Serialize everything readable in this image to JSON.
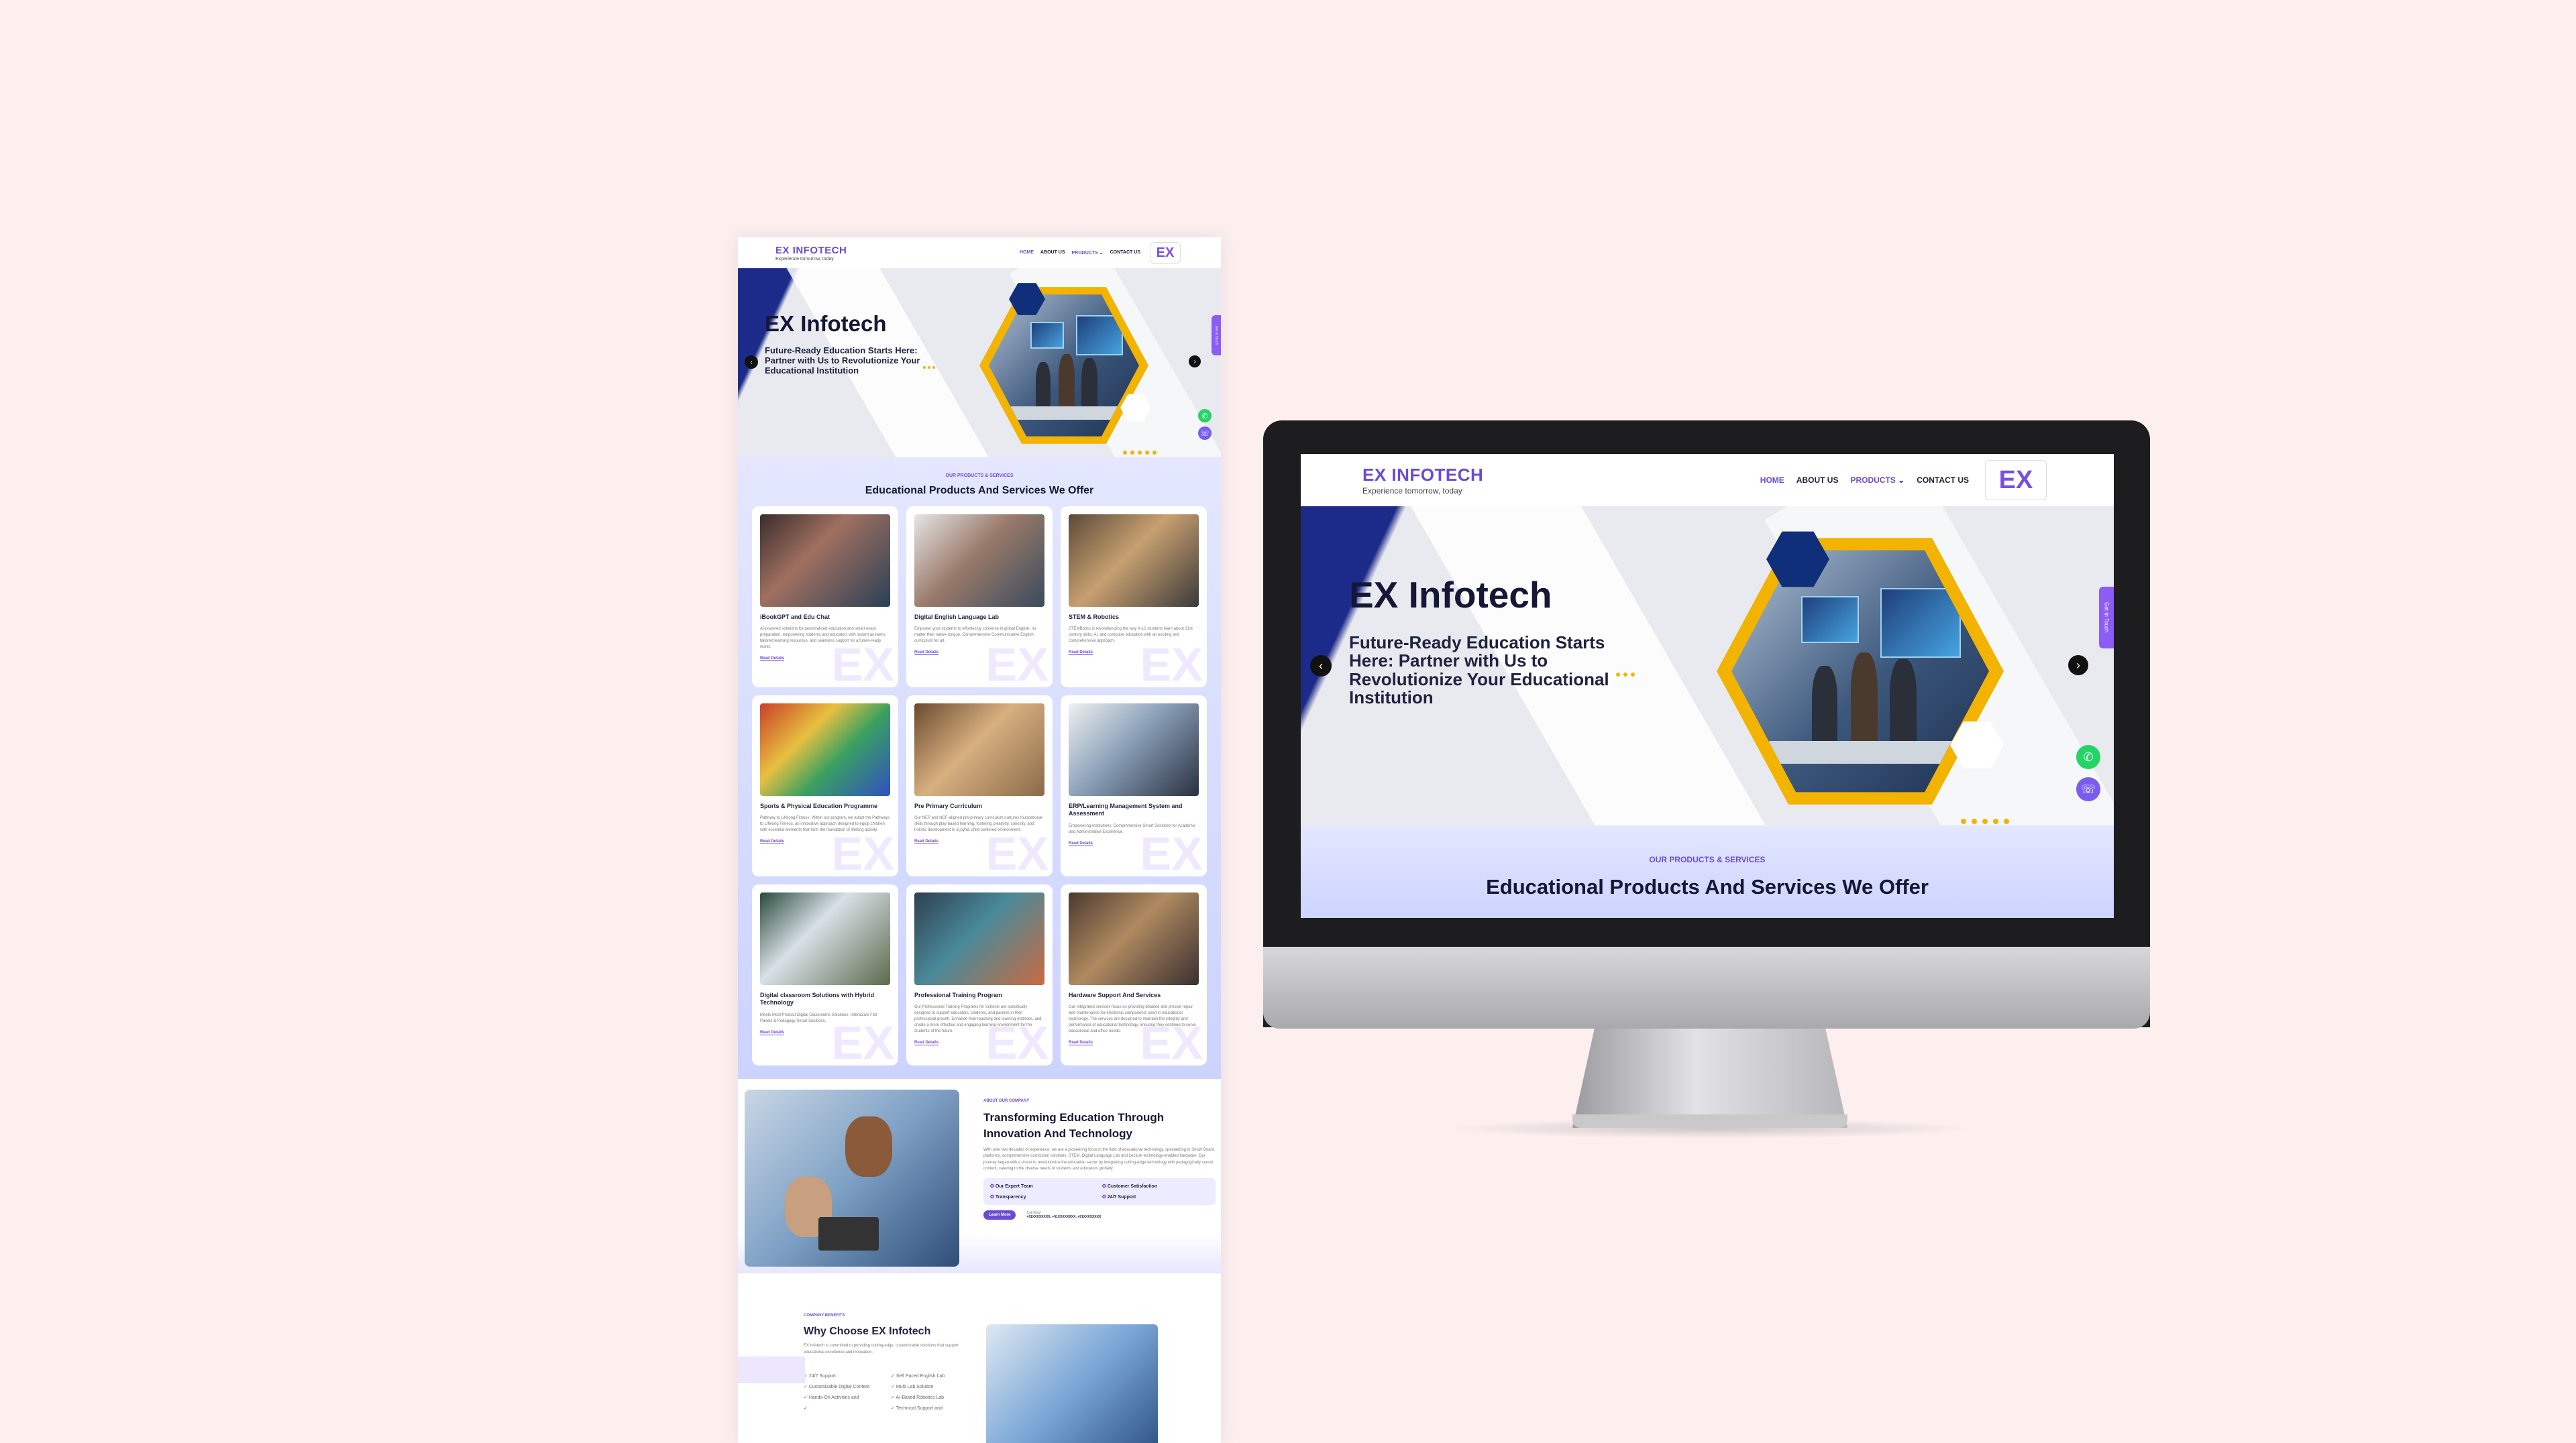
{
  "site": {
    "logo": "EX INFOTECH",
    "tagline": "Experience tomorrow, today",
    "badge": "EX",
    "nav": [
      "HOME",
      "ABOUT US",
      "PRODUCTS",
      "CONTACT US"
    ],
    "brand_color": "#6b4bd6"
  },
  "hero": {
    "title": "EX Infotech",
    "subtitle": "Future-Ready Education Starts Here: Partner with Us to Revolutionize Your Educational Institution",
    "side_tab": "Get In Touch",
    "prev_icon": "chevron-left-icon",
    "next_icon": "chevron-right-icon"
  },
  "services": {
    "eyebrow": "OUR PRODUCTS & SERVICES",
    "heading": "Educational Products And Services We Offer",
    "read_more": "Read Details",
    "cards": [
      {
        "title": "iBookGPT and Edu Chat",
        "desc": "AI-powered solutions for personalized education and smart exam preparation, empowering students and educators with instant answers, tailored learning resources, and seamless support for a future-ready world."
      },
      {
        "title": "Digital English Language Lab",
        "desc": "Empower your students to effortlessly converse in global English, no matter their native tongue. Comprehensive Communicative English curriculum for all."
      },
      {
        "title": "STEM & Robotics",
        "desc": "STEMBotics is revolutionizing the way K-12 students learn about 21st century skills, AI, and computer education with an exciting and comprehensive approach."
      },
      {
        "title": "Sports & Physical Education Programme",
        "desc": "Pathway to Lifelong Fitness: Within our program, we adopt the Pathways to Lifelong Fitness, an innovative approach designed to equip children with essential elements that form the foundation of lifelong activity."
      },
      {
        "title": "Pre Primary Curriculum",
        "desc": "Our NEP and NCF-aligned pre-primary curriculum nurtures foundational skills through play-based learning, fostering creativity, curiosity, and holistic development in a joyful, child-centered environment."
      },
      {
        "title": "ERP/Learning Management System and Assessment",
        "desc": "Empowering institutions: Comprehensive Smart Solutions for Academic and Administrative Excellence."
      },
      {
        "title": "Digital classroom Solutions with Hybrid Technology",
        "desc": "Meets Most Product Digital Classrooms Solutions, Interactive Flat Panels & Pedagogy Smart Solutions."
      },
      {
        "title": "Professional Training Program",
        "desc": "Our Professional Training Programs for Schools are specifically designed to support educators, students, and parents in their professional growth. Enhance their teaching and learning methods, and create a more effective and engaging learning environment for the students of the future."
      },
      {
        "title": "Hardware Support And Services",
        "desc": "Our Integrated services focus on providing detailed and precise repair and maintenance for electronic components used in educational technology. The services are designed to maintain the integrity and performance of educational technology, ensuring they continue to serve educational and office needs."
      }
    ]
  },
  "about": {
    "eyebrow": "ABOUT OUR COMPANY",
    "heading": "Transforming Education Through Innovation And Technology",
    "desc": "With over two decades of experience, we are a pioneering force in the field of educational technology, specializing in Smart Board platforms, comprehensive curriculum solutions, STEM, Digital Language Lab and Lecture technology-enabled hardware. Our journey began with a vision to revolutionize the education sector by integrating cutting-edge technology with pedagogically sound content, catering to the diverse needs of students and educators globally.",
    "features": [
      "Our Expert Team",
      "Customer Satisfaction",
      "Transparency",
      "24/7 Support"
    ],
    "button": "Learn More",
    "call_label": "Call Now!",
    "phones": "+91XXXXXXXX, +91XXXXXXXX, +91XXXXXXXX"
  },
  "why": {
    "eyebrow": "COMPANY BENEFITS",
    "heading": "Why Choose EX Infotech",
    "desc": "EX Infotech is committed to providing cutting-edge, customizable solutions that support educational excellence and innovation.",
    "items": [
      "24/7 Support",
      "Self Paced English Lab",
      "Customizable Digital Content",
      "Multi Lab Solution",
      "Hands-On Activities and",
      "AI-Based Robotics Lab",
      "",
      "Technical Support and"
    ]
  },
  "monitor": {
    "title": "EX Infotech",
    "subtitle": "Future-Ready Education Starts Here: Partner with Us to Revolutionize Your Educational Institution",
    "eyebrow": "OUR PRODUCTS & SERVICES",
    "heading": "Educational Products And Services We Offer",
    "side_tab": "Get In Touch"
  }
}
